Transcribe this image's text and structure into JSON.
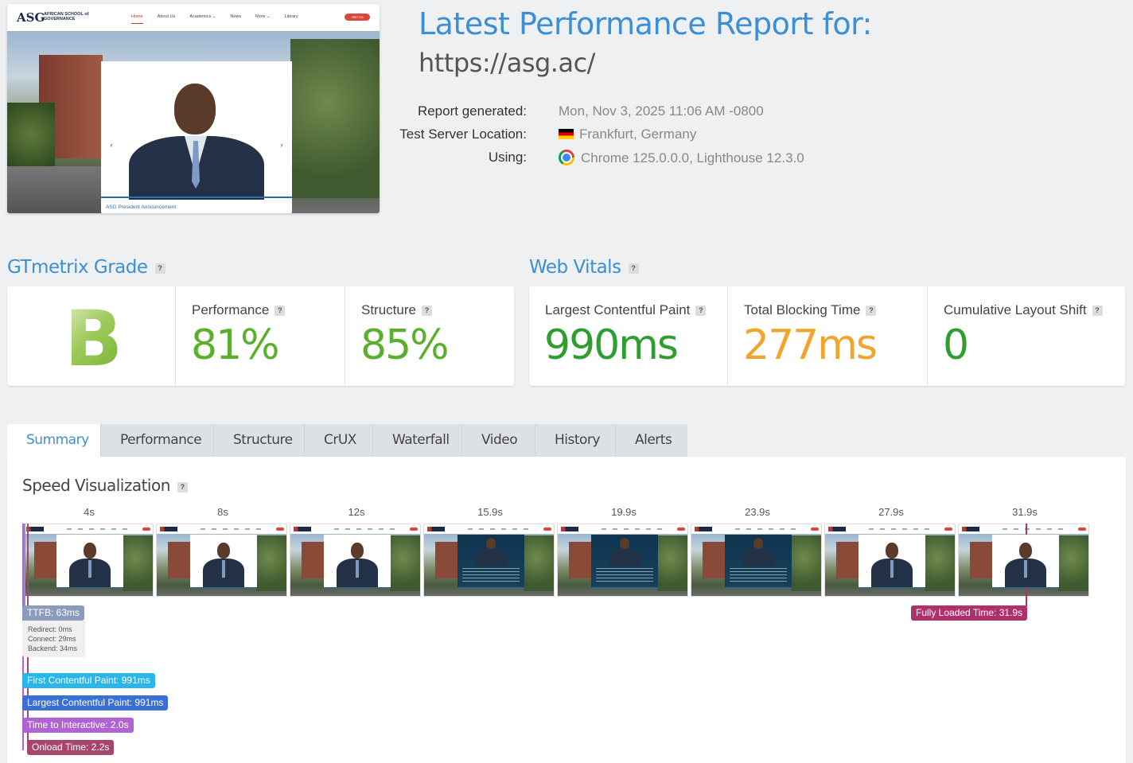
{
  "preview": {
    "logo_mark": "ASG",
    "logo_text": "AFRICAN SCHOOL of GOVERNANCE",
    "nav": [
      "Home",
      "About Us",
      "Academics ⌄",
      "News",
      "More ⌄",
      "Library"
    ],
    "join_label": "Join Us",
    "caption": "ASG President Announcement"
  },
  "header": {
    "title": "Latest Performance Report for:",
    "url": "https://asg.ac/",
    "meta": [
      {
        "label": "Report generated:",
        "value": "Mon, Nov 3, 2025 11:06 AM -0800",
        "icon": ""
      },
      {
        "label": "Test Server Location:",
        "value": "Frankfurt, Germany",
        "icon": "flag-de-icon"
      },
      {
        "label": "Using:",
        "value": "Chrome 125.0.0.0, Lighthouse 12.3.0",
        "icon": "chrome-icon"
      }
    ]
  },
  "grade": {
    "heading": "GTmetrix Grade",
    "letter": "B",
    "performance_label": "Performance",
    "performance_value": "81%",
    "structure_label": "Structure",
    "structure_value": "85%"
  },
  "vitals": {
    "heading": "Web Vitals",
    "lcp_label": "Largest Contentful Paint",
    "lcp_value": "990ms",
    "tbt_label": "Total Blocking Time",
    "tbt_value": "277ms",
    "cls_label": "Cumulative Layout Shift",
    "cls_value": "0"
  },
  "colors": {
    "accent": "#3a8fd6",
    "good": "#5aaf2d",
    "great": "#2e9e2e",
    "warn": "#f2a52b",
    "ttfb": "#8c9bbd",
    "fcp": "#2ab6ea",
    "lcp": "#3a6fd6",
    "tti": "#b064d4",
    "onload": "#a8456e",
    "fully": "#b0306b"
  },
  "tabs": [
    "Summary",
    "Performance",
    "Structure",
    "CrUX",
    "Waterfall",
    "Video",
    "History",
    "Alerts"
  ],
  "speed": {
    "heading": "Speed Visualization",
    "frame_times": [
      "4s",
      "8s",
      "12s",
      "15.9s",
      "19.9s",
      "23.9s",
      "27.9s",
      "31.9s"
    ],
    "ttfb_label": "TTFB: 63ms",
    "ttfb_details": [
      "Redirect: 0ms",
      "Connect: 29ms",
      "Backend: 34ms"
    ],
    "fcp_label": "First Contentful Paint: 991ms",
    "lcp_label": "Largest Contentful Paint: 991ms",
    "tti_label": "Time to Interactive: 2.0s",
    "onload_label": "Onload Time: 2.2s",
    "fully_label": "Fully Loaded Time: 31.9s"
  },
  "help_icon": "?"
}
